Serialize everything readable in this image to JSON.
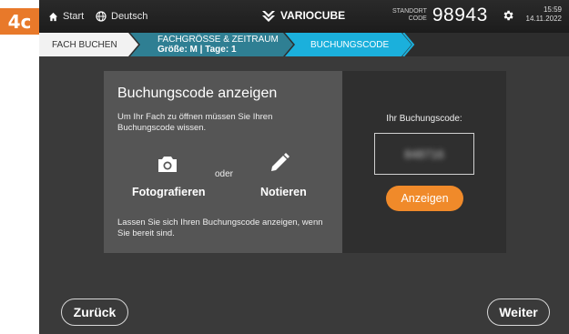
{
  "label": "4c",
  "topbar": {
    "start": "Start",
    "language": "Deutsch",
    "brand": "VARIOCUBE",
    "standort_caption_1": "STANDORT",
    "standort_caption_2": "CODE",
    "standort_code": "98943",
    "time": "15:59",
    "date": "14.11.2022"
  },
  "steps": {
    "step1": "FACH BUCHEN",
    "step2_title": "FACHGRÖSSE & ZEITRAUM",
    "step2_detail": "Größe: M | Tage: 1",
    "step3": "BUCHUNGSCODE"
  },
  "main": {
    "heading": "Buchungscode anzeigen",
    "intro": "Um Ihr Fach zu öffnen müssen Sie Ihren Buchungscode wissen.",
    "option_photo": "Fotografieren",
    "option_or": "oder",
    "option_note": "Notieren",
    "footer_text": "Lassen Sie sich Ihren Buchungscode anzeigen, wenn Sie bereit sind.",
    "code_label": "Ihr Buchungscode:",
    "code_value": "848716",
    "show_button": "Anzeigen"
  },
  "nav": {
    "back": "Zurück",
    "next": "Weiter"
  },
  "colors": {
    "accent_orange": "#f08a2a",
    "step_active_blue": "#1bb0dc",
    "step_mid_teal": "#2f7f93",
    "label_orange": "#e8792a"
  },
  "icons": [
    "home-icon",
    "globe-icon",
    "variocube-logo-icon",
    "gear-icon",
    "camera-icon",
    "pencil-icon"
  ]
}
